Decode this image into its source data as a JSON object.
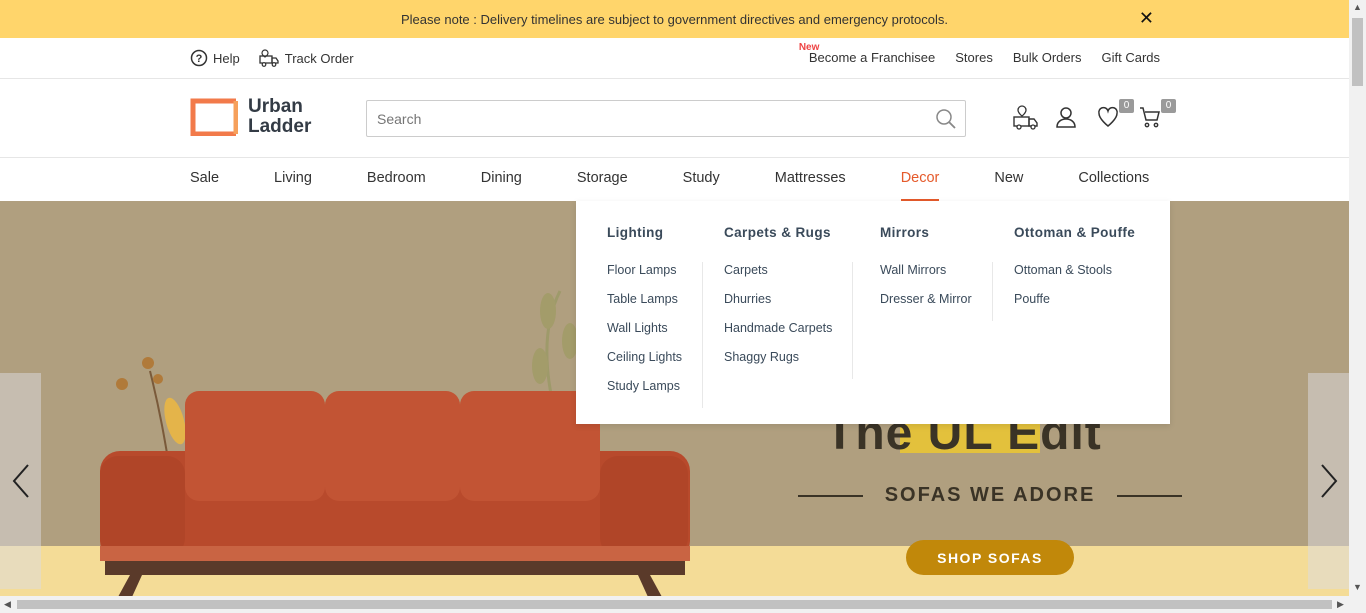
{
  "notice": {
    "text": "Please note : Delivery timelines are subject to government directives and emergency protocols.",
    "close": "✕"
  },
  "utility": {
    "help": "Help",
    "track_order": "Track Order",
    "new_tag": "New",
    "right_links": [
      "Become a Franchisee",
      "Stores",
      "Bulk Orders",
      "Gift Cards"
    ]
  },
  "header": {
    "logo_line1": "Urban",
    "logo_line2": "Ladder",
    "search_placeholder": "Search",
    "wishlist_count": "0",
    "cart_count": "0"
  },
  "nav": {
    "items": [
      "Sale",
      "Living",
      "Bedroom",
      "Dining",
      "Storage",
      "Study",
      "Mattresses",
      "Decor",
      "New",
      "Collections"
    ],
    "active": "Decor"
  },
  "dropdown": {
    "columns": [
      {
        "heading": "Lighting",
        "links": [
          "Floor Lamps",
          "Table Lamps",
          "Wall Lights",
          "Ceiling Lights",
          "Study Lamps"
        ]
      },
      {
        "heading": "Carpets & Rugs",
        "links": [
          "Carpets",
          "Dhurries",
          "Handmade Carpets",
          "Shaggy Rugs"
        ]
      },
      {
        "heading": "Mirrors",
        "links": [
          "Wall Mirrors",
          "Dresser & Mirror"
        ]
      },
      {
        "heading": "Ottoman & Pouffe",
        "links": [
          "Ottoman & Stools",
          "Pouffe"
        ]
      }
    ]
  },
  "hero": {
    "title": "The UL Edit",
    "subtitle": "SOFAS WE ADORE",
    "cta": "SHOP SOFAS",
    "colors": {
      "bg": "#b09f7f",
      "band": "#f4dc97",
      "cta": "#c1880a",
      "sofa": "#b84a2c"
    }
  }
}
